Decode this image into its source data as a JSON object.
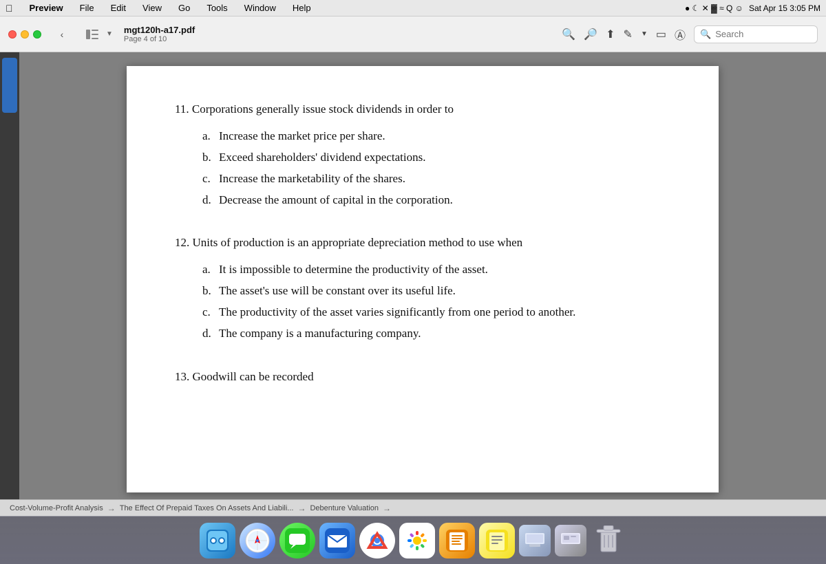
{
  "menubar": {
    "apple": "⌘",
    "items": [
      "Preview",
      "File",
      "Edit",
      "View",
      "Go",
      "Tools",
      "Window",
      "Help"
    ],
    "right": "Sat Apr 15  3:05 PM"
  },
  "toolbar": {
    "filename": "mgt120h-a17.pdf",
    "page_info": "Page 4 of 10",
    "search_placeholder": "Search"
  },
  "breadcrumb": {
    "items": [
      "Cost-Volume-Profit Analysis",
      "The Effect Of Prepaid Taxes On Assets And Liabili...",
      "Debenture Valuation"
    ]
  },
  "questions": [
    {
      "number": "11.",
      "text": "Corporations generally issue stock dividends in order to",
      "answers": [
        {
          "label": "a.",
          "text": "Increase the market price per share."
        },
        {
          "label": "b.",
          "text": "Exceed shareholders' dividend expectations."
        },
        {
          "label": "c.",
          "text": "Increase the marketability of the shares."
        },
        {
          "label": "d.",
          "text": "Decrease the amount of capital in the corporation."
        }
      ]
    },
    {
      "number": "12.",
      "text": "Units of production is an appropriate depreciation method to use when",
      "answers": [
        {
          "label": "a.",
          "text": "It is impossible to determine the productivity of the asset."
        },
        {
          "label": "b.",
          "text": "The asset's use will be constant over its useful life."
        },
        {
          "label": "c.",
          "text": "The productivity of the asset varies significantly from one period to another."
        },
        {
          "label": "d.",
          "text": "The company is a manufacturing company."
        }
      ]
    },
    {
      "number": "13.",
      "text": "Goodwill can be recorded"
    }
  ],
  "dock": {
    "items": [
      "Finder",
      "Safari",
      "Messages",
      "Mail",
      "Chrome",
      "Photos",
      "Pages",
      "Notes",
      "Window1",
      "Window2",
      "Trash"
    ]
  }
}
